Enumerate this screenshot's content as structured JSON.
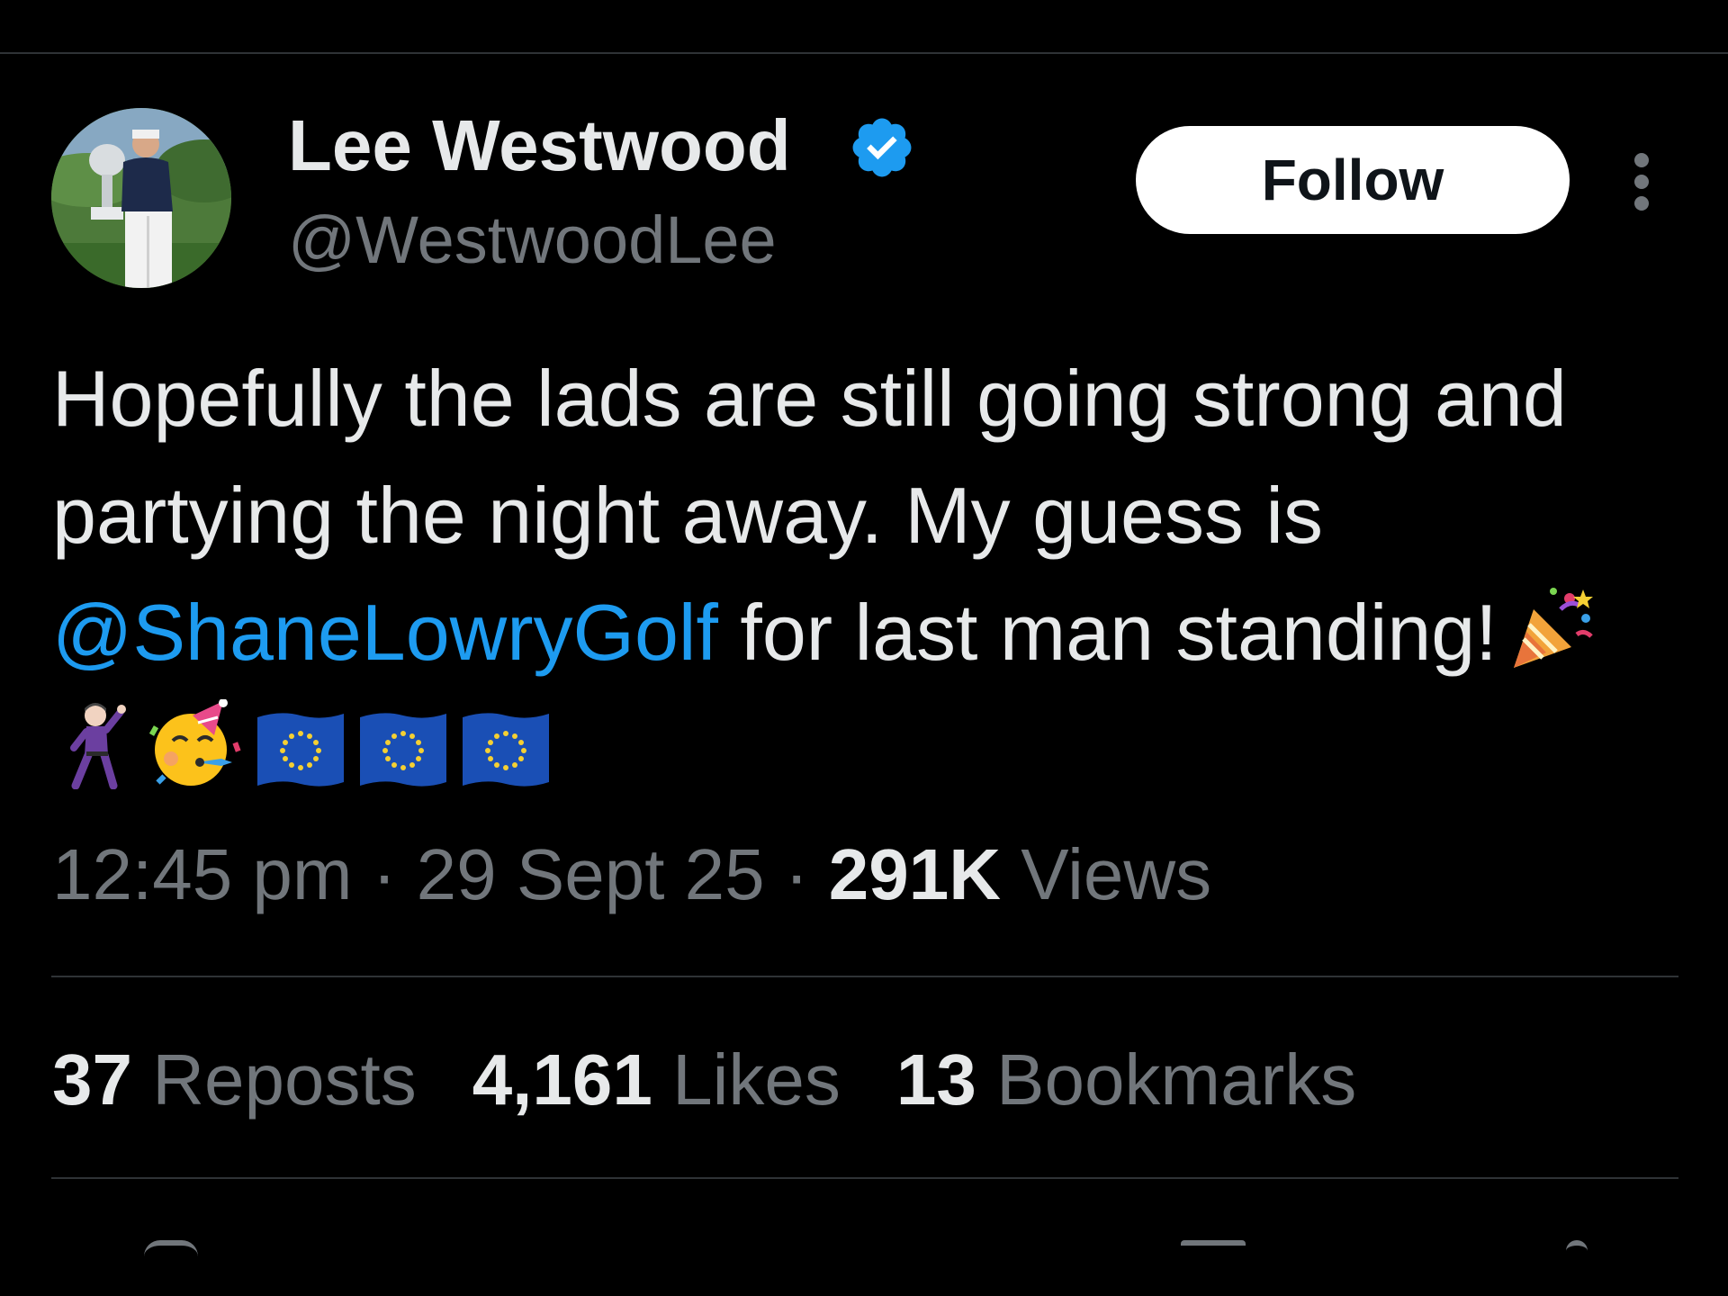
{
  "author": {
    "name": "Lee Westwood",
    "handle": "@WestwoodLee",
    "verified_badge_icon": "verified-check-icon"
  },
  "follow_label": "Follow",
  "more_icon": "more-vertical-icon",
  "tweet": {
    "text_before_mention": "Hopefully the lads are still going strong and partying the night away. My guess is ",
    "mention": "@ShaneLowryGolf",
    "text_after_mention": " for last man standing!",
    "emojis": [
      "party-popper-emoji",
      "man-dancing-emoji",
      "partying-face-emoji",
      "eu-flag-emoji",
      "eu-flag-emoji",
      "eu-flag-emoji"
    ]
  },
  "meta": {
    "time": "12:45 pm",
    "separator": " · ",
    "date": "29 Sept 25",
    "views_count": "291K",
    "views_label": " Views"
  },
  "stats": [
    {
      "count": "37",
      "label": " Reposts"
    },
    {
      "count": "4,161",
      "label": " Likes"
    },
    {
      "count": "13",
      "label": " Bookmarks"
    }
  ],
  "colors": {
    "background": "#000000",
    "text": "#e7e9ea",
    "secondary": "#71767b",
    "accent": "#1d9bf0",
    "divider": "#2f3336"
  }
}
